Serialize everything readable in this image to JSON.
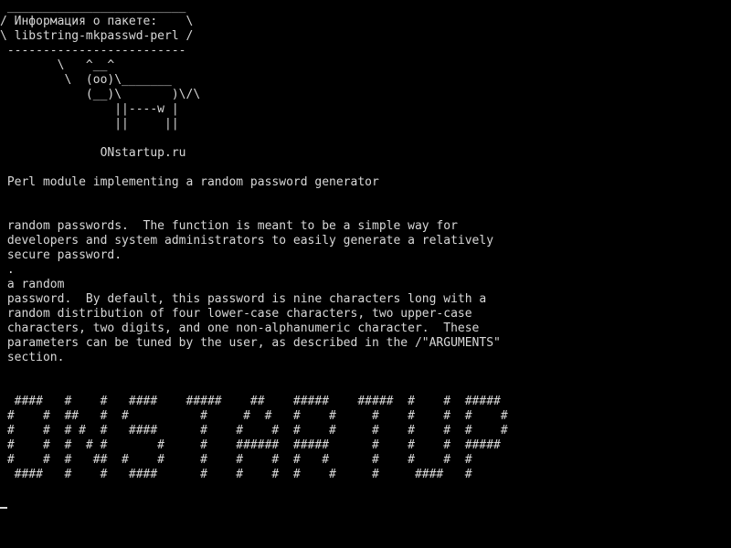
{
  "terminal": {
    "lines": [
      " _________________________",
      "/ Информация о пакете:    \\",
      "\\ libstring-mkpasswd-perl /",
      " -------------------------",
      "        \\   ^__^",
      "         \\  (oo)\\_______",
      "            (__)\\       )\\/\\",
      "                ||----w |",
      "                ||     ||",
      "",
      "              ONstartup.ru",
      "",
      " Perl module implementing a random password generator",
      "",
      "",
      " random passwords.  The function is meant to be a simple way for",
      " developers and system administrators to easily generate a relatively",
      " secure password.",
      " .",
      " a random",
      " password.  By default, this password is nine characters long with a",
      " random distribution of four lower-case characters, two upper-case",
      " characters, two digits, and one non-alphanumeric character.  These",
      " parameters can be tuned by the user, as described in the /\"ARGUMENTS\"",
      " section.",
      "",
      "",
      "  ####   #    #   ####    #####    ##    #####    #####  #    #  #####",
      " #    #  ##   #  #          #     #  #   #    #     #    #    #  #    #",
      " #    #  # #  #   ####      #    #    #  #    #     #    #    #  #    #",
      " #    #  #  # #       #     #    ######  #####      #    #    #  #####",
      " #    #  #   ##  #    #     #    #    #  #   #      #    #    #  #",
      "  ####   #    #   ####      #    #    #  #    #     #     ####   #"
    ]
  }
}
